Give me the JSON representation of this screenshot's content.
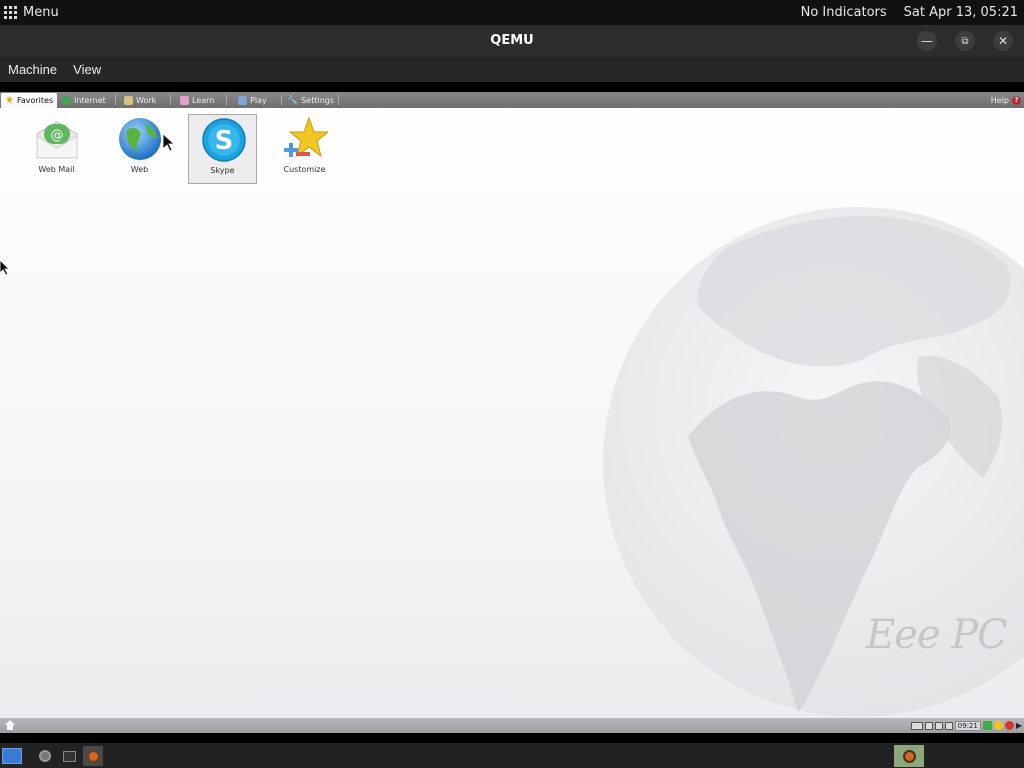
{
  "host_topbar": {
    "menu_label": "Menu",
    "indicators": "No Indicators",
    "datetime": "Sat Apr 13, 05:21"
  },
  "qemu_window": {
    "title": "QEMU",
    "menu": [
      "Machine",
      "View"
    ]
  },
  "guest": {
    "tabs": [
      {
        "label": "Favorites",
        "icon": "star-icon",
        "active": true
      },
      {
        "label": "Internet",
        "icon": "globe-icon",
        "active": false
      },
      {
        "label": "Work",
        "icon": "briefcase-icon",
        "active": false
      },
      {
        "label": "Learn",
        "icon": "book-icon",
        "active": false
      },
      {
        "label": "Play",
        "icon": "gamepad-icon",
        "active": false
      },
      {
        "label": "Settings",
        "icon": "wrench-icon",
        "active": false
      }
    ],
    "help_label": "Help",
    "help_icon": "?",
    "desktop_icons": [
      {
        "label": "Web Mail",
        "icon": "webmail-icon"
      },
      {
        "label": "Web",
        "icon": "web-globe-icon"
      },
      {
        "label": "Skype",
        "icon": "skype-icon",
        "selected": true
      },
      {
        "label": "Customize",
        "icon": "customize-star-icon"
      }
    ],
    "watermark": "Eee PC",
    "tray_clock": "09:21"
  },
  "colors": {
    "host_bg": "#111111",
    "guest_tabbar": "#7a7a7a",
    "skype_blue": "#1aa3e0"
  }
}
